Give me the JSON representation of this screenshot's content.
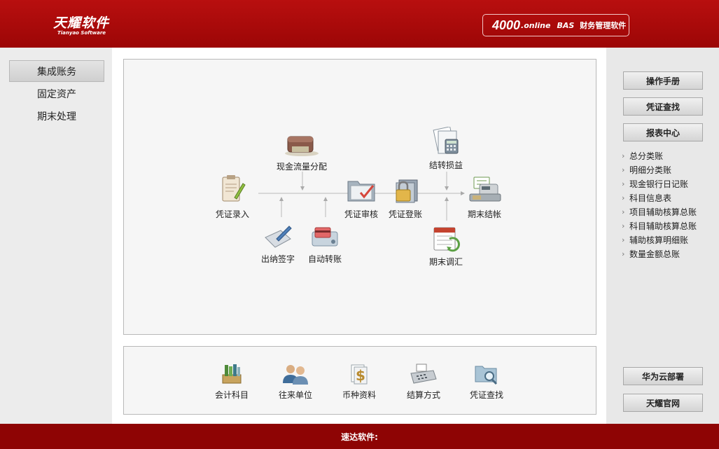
{
  "header": {
    "logo_cn": "天耀软件",
    "logo_en": "Tianyao Software",
    "product_num": "4000",
    "product_online": ".online",
    "product_bas": "BAS",
    "product_cn": "财务管理软件"
  },
  "left_nav": [
    "集成账务",
    "固定资产",
    "期末处理"
  ],
  "flow": {
    "voucher_entry": "凭证录入",
    "cashflow": "现金流量分配",
    "cashier_sign": "出纳签字",
    "auto_transfer": "自动转账",
    "voucher_audit": "凭证审核",
    "voucher_post": "凭证登账",
    "carry_pl": "结转损益",
    "period_adjust": "期末调汇",
    "period_close": "期末结帐"
  },
  "bottom": [
    "会计科目",
    "往来单位",
    "币种资料",
    "结算方式",
    "凭证查找"
  ],
  "right": {
    "buttons": [
      "操作手册",
      "凭证查找",
      "报表中心"
    ],
    "links": [
      "总分类账",
      "明细分类账",
      "现金银行日记账",
      "科目信息表",
      "项目辅助核算总账",
      "科目辅助核算总账",
      "辅助核算明细账",
      "数量金额总账"
    ],
    "bottom_buttons": [
      "华为云部署",
      "天耀官网"
    ]
  },
  "footer": "速达软件:",
  "colors": {
    "brand_red": "#a90b0b",
    "footer_red": "#8e0404"
  }
}
